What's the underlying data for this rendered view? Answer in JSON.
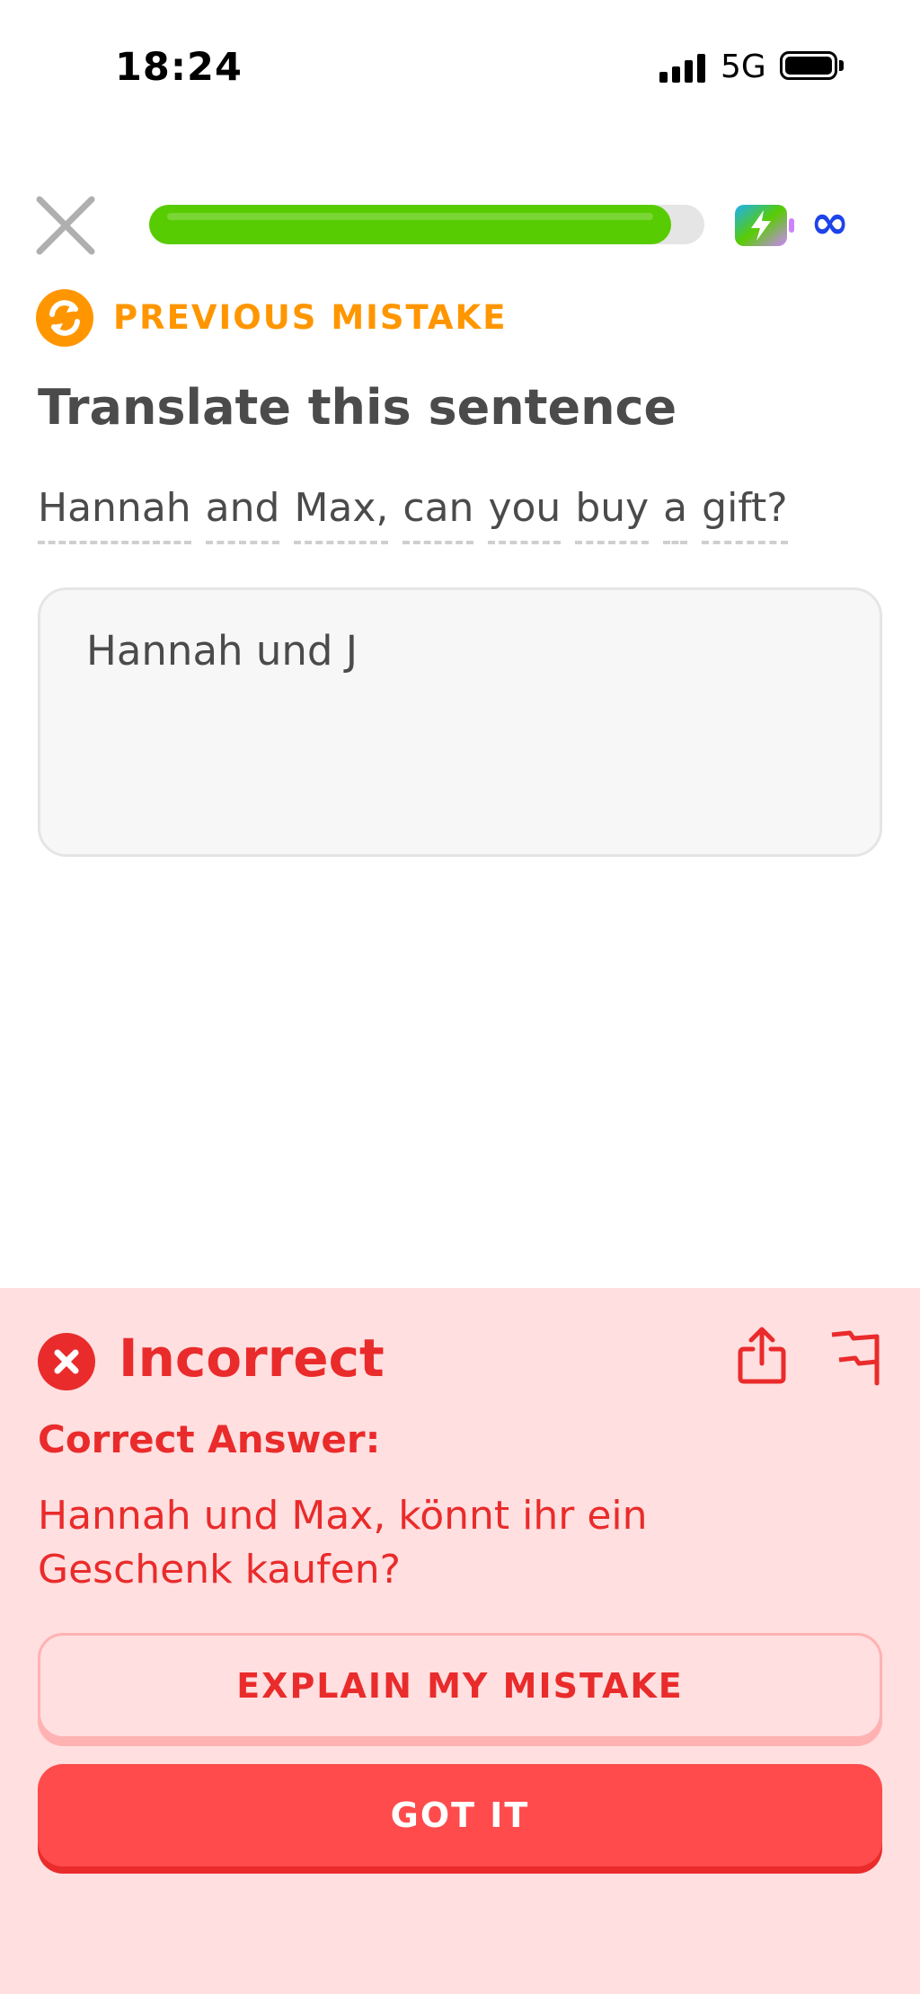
{
  "status_bar": {
    "time": "18:24",
    "network": "5G",
    "signal_bars": 4,
    "battery_level": 1.0
  },
  "lesson": {
    "progress": 0.94,
    "hearts": "∞",
    "colors": {
      "progress": "#58cc02",
      "warning": "#ff9600",
      "error": "#ea2b2b"
    }
  },
  "challenge": {
    "tag": "PREVIOUS MISTAKE",
    "title": "Translate this sentence",
    "sentence_tokens": [
      {
        "text": "Hannah",
        "dashed": true
      },
      {
        "text": "and",
        "dashed": true
      },
      {
        "text": "Max,",
        "dashed": true
      },
      {
        "text": "can",
        "dashed": true
      },
      {
        "text": "you",
        "dashed": true
      },
      {
        "text": "buy",
        "dashed": true
      },
      {
        "text": "a",
        "dashed": true
      },
      {
        "text": "gift?",
        "dashed": true
      }
    ],
    "answer_input": "Hannah und J"
  },
  "feedback": {
    "status": "Incorrect",
    "correct_label": "Correct Answer:",
    "correct_answer": "Hannah und Max, könnt ihr ein Geschenk kaufen?",
    "explain_button": "EXPLAIN MY MISTAKE",
    "got_it_button": "GOT IT",
    "icons": [
      "close-icon",
      "energy-icon",
      "infinity-icon",
      "refresh-icon",
      "x-icon",
      "share-icon",
      "flag-icon"
    ]
  }
}
